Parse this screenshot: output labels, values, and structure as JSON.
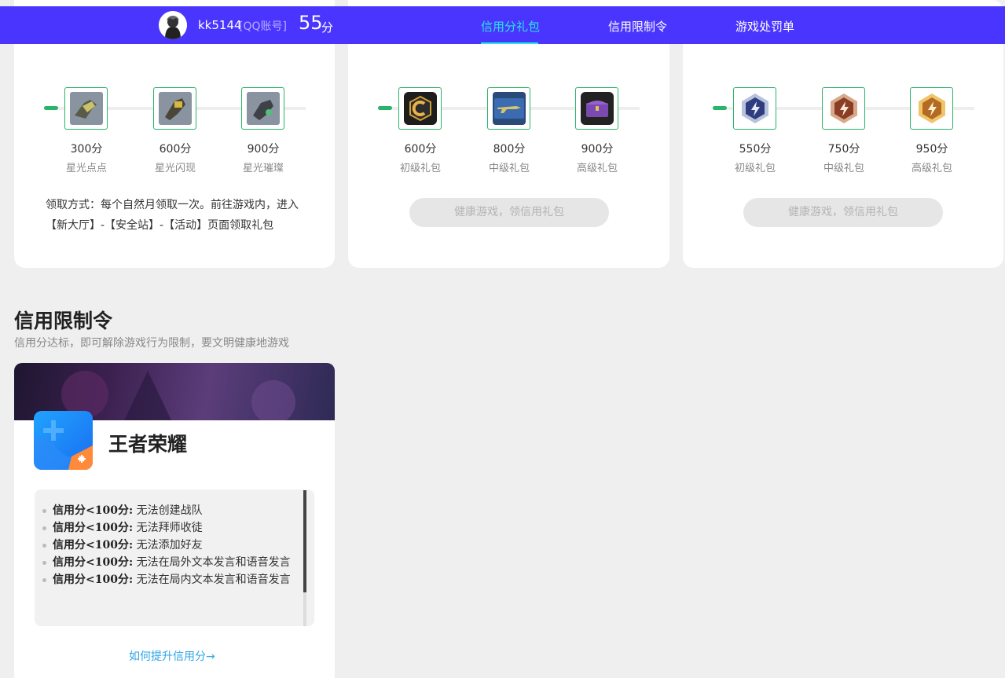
{
  "user": {
    "name": "kk5144",
    "account_type": "[QQ账号]",
    "score": "55",
    "score_unit": "分"
  },
  "nav": [
    {
      "label": "信用分礼包",
      "active": true
    },
    {
      "label": "信用限制令",
      "active": false
    },
    {
      "label": "游戏处罚单",
      "active": false
    }
  ],
  "card1": {
    "rewards": [
      {
        "points": "300分",
        "name": "星光点点"
      },
      {
        "points": "600分",
        "name": "星光闪现"
      },
      {
        "points": "900分",
        "name": "星光璀璨"
      }
    ],
    "desc": "领取方式：每个自然月领取一次。前往游戏内，进入【新大厅】-【安全站】-【活动】页面领取礼包"
  },
  "card2": {
    "rewards": [
      {
        "points": "600分",
        "name": "初级礼包"
      },
      {
        "points": "800分",
        "name": "中级礼包"
      },
      {
        "points": "900分",
        "name": "高级礼包"
      }
    ],
    "button": "健康游戏，领信用礼包"
  },
  "card3": {
    "rewards": [
      {
        "points": "550分",
        "name": "初级礼包"
      },
      {
        "points": "750分",
        "name": "中级礼包"
      },
      {
        "points": "950分",
        "name": "高级礼包"
      }
    ],
    "button": "健康游戏，领信用礼包"
  },
  "restrictions": {
    "title": "信用限制令",
    "subtitle": "信用分达标，即可解除游戏行为限制，要文明健康地游戏",
    "game": "王者荣耀",
    "rules": [
      {
        "cond": "信用分<100分:",
        "text": "无法创建战队"
      },
      {
        "cond": "信用分<100分:",
        "text": "无法拜师收徒"
      },
      {
        "cond": "信用分<100分:",
        "text": "无法添加好友"
      },
      {
        "cond": "信用分<100分:",
        "text": "无法在局外文本发言和语音发言"
      },
      {
        "cond": "信用分<100分:",
        "text": "无法在局内文本发言和语音发言"
      }
    ],
    "howto": "如何提升信用分→"
  },
  "colors": {
    "topbar": "#4a35ff",
    "active_nav": "#27e8e8",
    "reward_border": "#2ab36a",
    "link": "#2ea5e8"
  }
}
